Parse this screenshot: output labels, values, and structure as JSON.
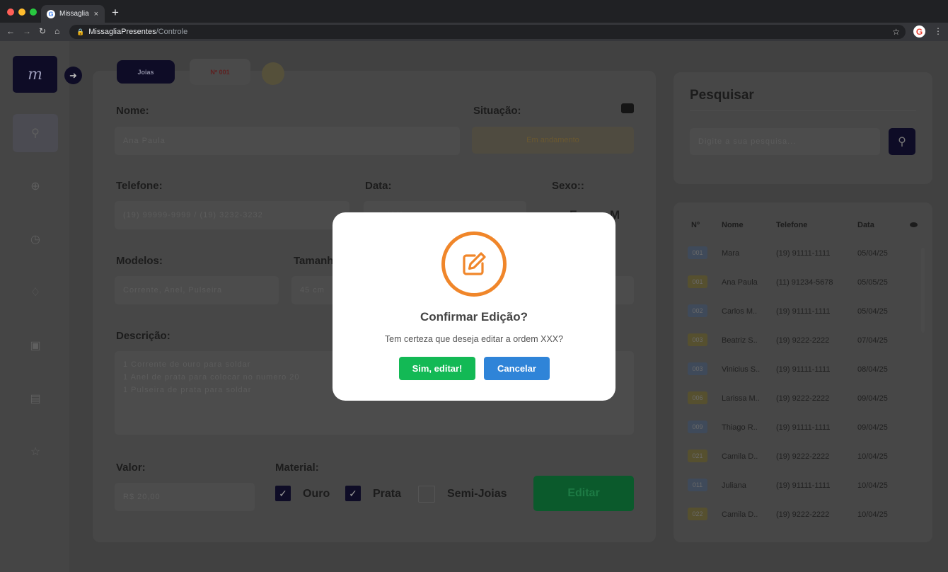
{
  "browser": {
    "tab_title": "Missaglia",
    "tab_close": "×",
    "new_tab": "+",
    "url_host": "MissagliaPresentes",
    "url_path": "/Controle"
  },
  "app": {
    "logo_text": "m",
    "tabs": {
      "active": "Joias",
      "order": "Nº 001"
    },
    "form": {
      "nome_label": "Nome:",
      "nome_value": "Ana Paula",
      "situacao_label": "Situação:",
      "situacao_value": "Em andamento",
      "telefone_label": "Telefone:",
      "telefone_placeholder": "(19) 99999-9999 / (19) 3232-3232",
      "data_label": "Data:",
      "data_value": "mm/dd/yyyy",
      "sexo_label": "Sexo::",
      "sexo_f": "F",
      "sexo_m": "M",
      "modelos_label": "Modelos:",
      "modelos_placeholder": "Corrente, Anel, Pulseira",
      "tamanho_label": "Tamanho:",
      "tamanho_placeholder": "45 cm",
      "descricao_label": "Descrição:",
      "descricao_lines": [
        "1 Corrente de ouro para soldar",
        "1 Anel de prata para colocar no numero 20",
        "1 Pulseira de prata para soldar"
      ],
      "valor_label": "Valor:",
      "valor_value": "R$ 20,00",
      "material_label": "Material:",
      "material_options": [
        "Ouro",
        "Prata",
        "Semi-Joias"
      ],
      "material_checked": [
        true,
        true,
        false
      ],
      "editar_label": "Editar"
    },
    "search": {
      "title": "Pesquisar",
      "placeholder": "Digite a sua pesquisa..."
    },
    "table": {
      "headers": [
        "Nº",
        "Nome",
        "Telefone",
        "Data"
      ],
      "rows": [
        {
          "num": "001",
          "nome": "Mara",
          "telefone": "(19) 91111-1111",
          "data": "05/04/25",
          "tag": "blue"
        },
        {
          "num": "001",
          "nome": "Ana Paula",
          "telefone": "(11) 91234-5678",
          "data": "05/05/25",
          "tag": "yellow"
        },
        {
          "num": "002",
          "nome": "Carlos M..",
          "telefone": "(19) 91111-1111",
          "data": "05/04/25",
          "tag": "blue"
        },
        {
          "num": "003",
          "nome": "Beatriz S..",
          "telefone": "(19) 9222-2222",
          "data": "07/04/25",
          "tag": "yellow"
        },
        {
          "num": "003",
          "nome": "Vinicius S..",
          "telefone": "(19) 91111-1111",
          "data": "08/04/25",
          "tag": "blue"
        },
        {
          "num": "006",
          "nome": "Larissa M..",
          "telefone": "(19) 9222-2222",
          "data": "09/04/25",
          "tag": "yellow"
        },
        {
          "num": "009",
          "nome": "Thiago R..",
          "telefone": "(19) 91111-1111",
          "data": "09/04/25",
          "tag": "blue"
        },
        {
          "num": "021",
          "nome": "Camila D..",
          "telefone": "(19) 9222-2222",
          "data": "10/04/25",
          "tag": "yellow"
        },
        {
          "num": "011",
          "nome": "Juliana",
          "telefone": "(19) 91111-1111",
          "data": "10/04/25",
          "tag": "blue"
        },
        {
          "num": "022",
          "nome": "Camila D..",
          "telefone": "(19) 9222-2222",
          "data": "10/04/25",
          "tag": "yellow"
        }
      ]
    }
  },
  "modal": {
    "title": "Confirmar Edição?",
    "message": "Tem certeza que deseja editar a ordem XXX?",
    "confirm_label": "Sim, editar!",
    "cancel_label": "Cancelar"
  },
  "colors": {
    "accent_orange": "#f0862a",
    "confirm_green": "#13b955",
    "cancel_blue": "#2f84d8",
    "brand_navy": "#0e0c26",
    "tag_blue": "#3f4a5a",
    "tag_yellow": "#56502f"
  }
}
